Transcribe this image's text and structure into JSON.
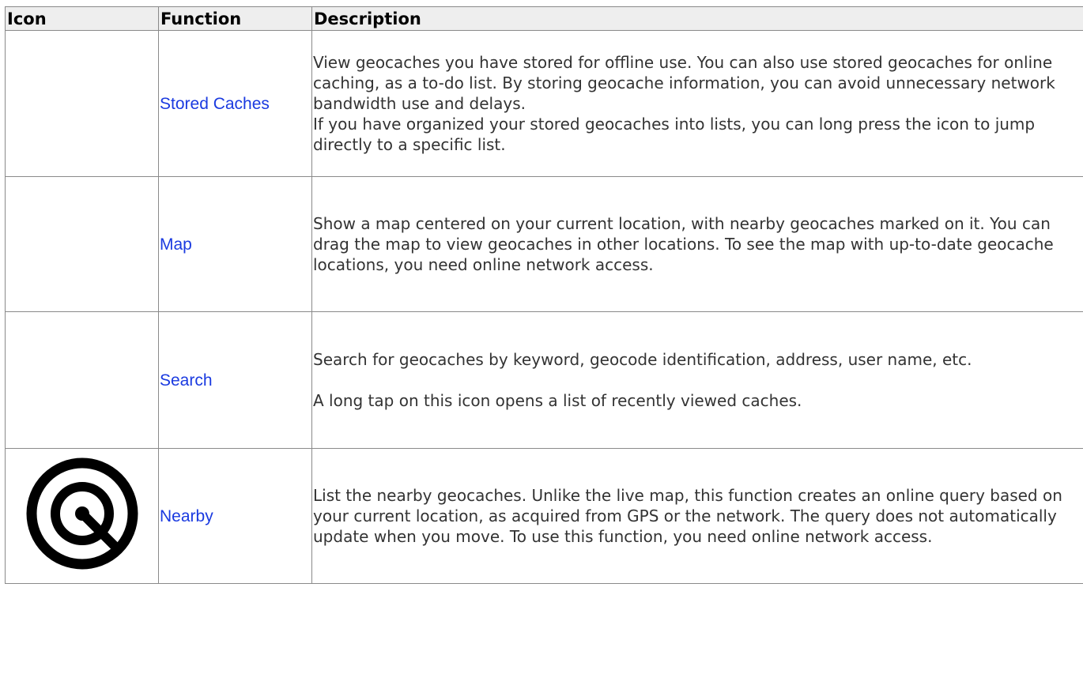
{
  "headers": {
    "icon": "Icon",
    "function": "Function",
    "description": "Description"
  },
  "rows": [
    {
      "function": "Stored Caches",
      "description": [
        "View geocaches you have stored for offline use. You can also use stored geocaches for online caching, as a to-do list. By storing geocache information, you can avoid unnecessary network bandwidth use and delays.",
        "If you have organized your stored geocaches into lists, you can long press the icon to jump directly to a specific list."
      ]
    },
    {
      "function": "Map",
      "description": [
        "Show a map centered on your current location, with nearby geocaches marked on it. You can drag the map to view geocaches in other locations. To see the map with up-to-date geocache locations, you need online network access."
      ]
    },
    {
      "function": "Search",
      "description": [
        "Search for geocaches by keyword, geocode identification, address, user name, etc.",
        "A long tap on this icon opens a list of recently viewed caches."
      ]
    },
    {
      "function": "Nearby",
      "icon": "nearby-target-icon",
      "description": [
        "List the nearby geocaches. Unlike the live map, this function creates an online query based on your current location, as acquired from GPS or the network. The query does not automatically update when you move. To use this function, you need online network access."
      ]
    }
  ],
  "colors": {
    "link": "#1a3ae0",
    "header_bg": "#eeeeee",
    "border": "#8a8a8a",
    "text": "#333333"
  }
}
